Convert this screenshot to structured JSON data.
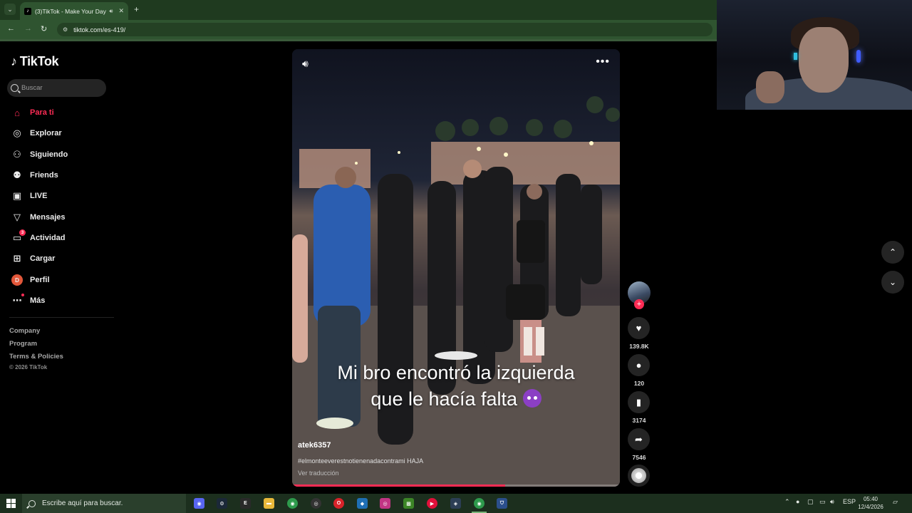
{
  "browser": {
    "tab_title": "(3)TikTok - Make Your Day",
    "url": "tiktok.com/es-419/",
    "new_tab": "+",
    "tab_close": "✕"
  },
  "sidebar": {
    "logo": "TikTok",
    "search_placeholder": "Buscar",
    "items": [
      {
        "label": "Para ti",
        "icon": "home-icon",
        "active": true
      },
      {
        "label": "Explorar",
        "icon": "compass-icon"
      },
      {
        "label": "Siguiendo",
        "icon": "person-check-icon"
      },
      {
        "label": "Friends",
        "icon": "friends-icon"
      },
      {
        "label": "LIVE",
        "icon": "live-tv-icon"
      },
      {
        "label": "Mensajes",
        "icon": "send-icon"
      },
      {
        "label": "Actividad",
        "icon": "inbox-icon",
        "badge": "3"
      },
      {
        "label": "Cargar",
        "icon": "upload-icon"
      },
      {
        "label": "Perfil",
        "icon": "avatar-icon",
        "avatar_letter": "D"
      },
      {
        "label": "Más",
        "icon": "more-icon"
      }
    ],
    "footer_links": [
      "Company",
      "Program",
      "Terms & Policies"
    ],
    "copyright": "© 2026 TikTok"
  },
  "video": {
    "caption_line1": "Mi bro encontró la izquierda",
    "caption_line2": "que le hacía falta",
    "author": "atek6357",
    "hashtags": "#elmonteeverestnotienenadacontrami HAJA",
    "translate_link": "Ver traducción",
    "progress": 0.65
  },
  "actions": {
    "likes": "139.8K",
    "comments": "120",
    "saves": "3174",
    "shares": "7546",
    "follow": "+"
  },
  "taskbar": {
    "search_placeholder": "Escribe aquí para buscar.",
    "language": "ESP",
    "time": "05:40",
    "date": "12/4/2026"
  },
  "colors": {
    "accent": "#fe2c55",
    "chrome": "#2f5430",
    "taskbar": "#1c2f1e"
  }
}
